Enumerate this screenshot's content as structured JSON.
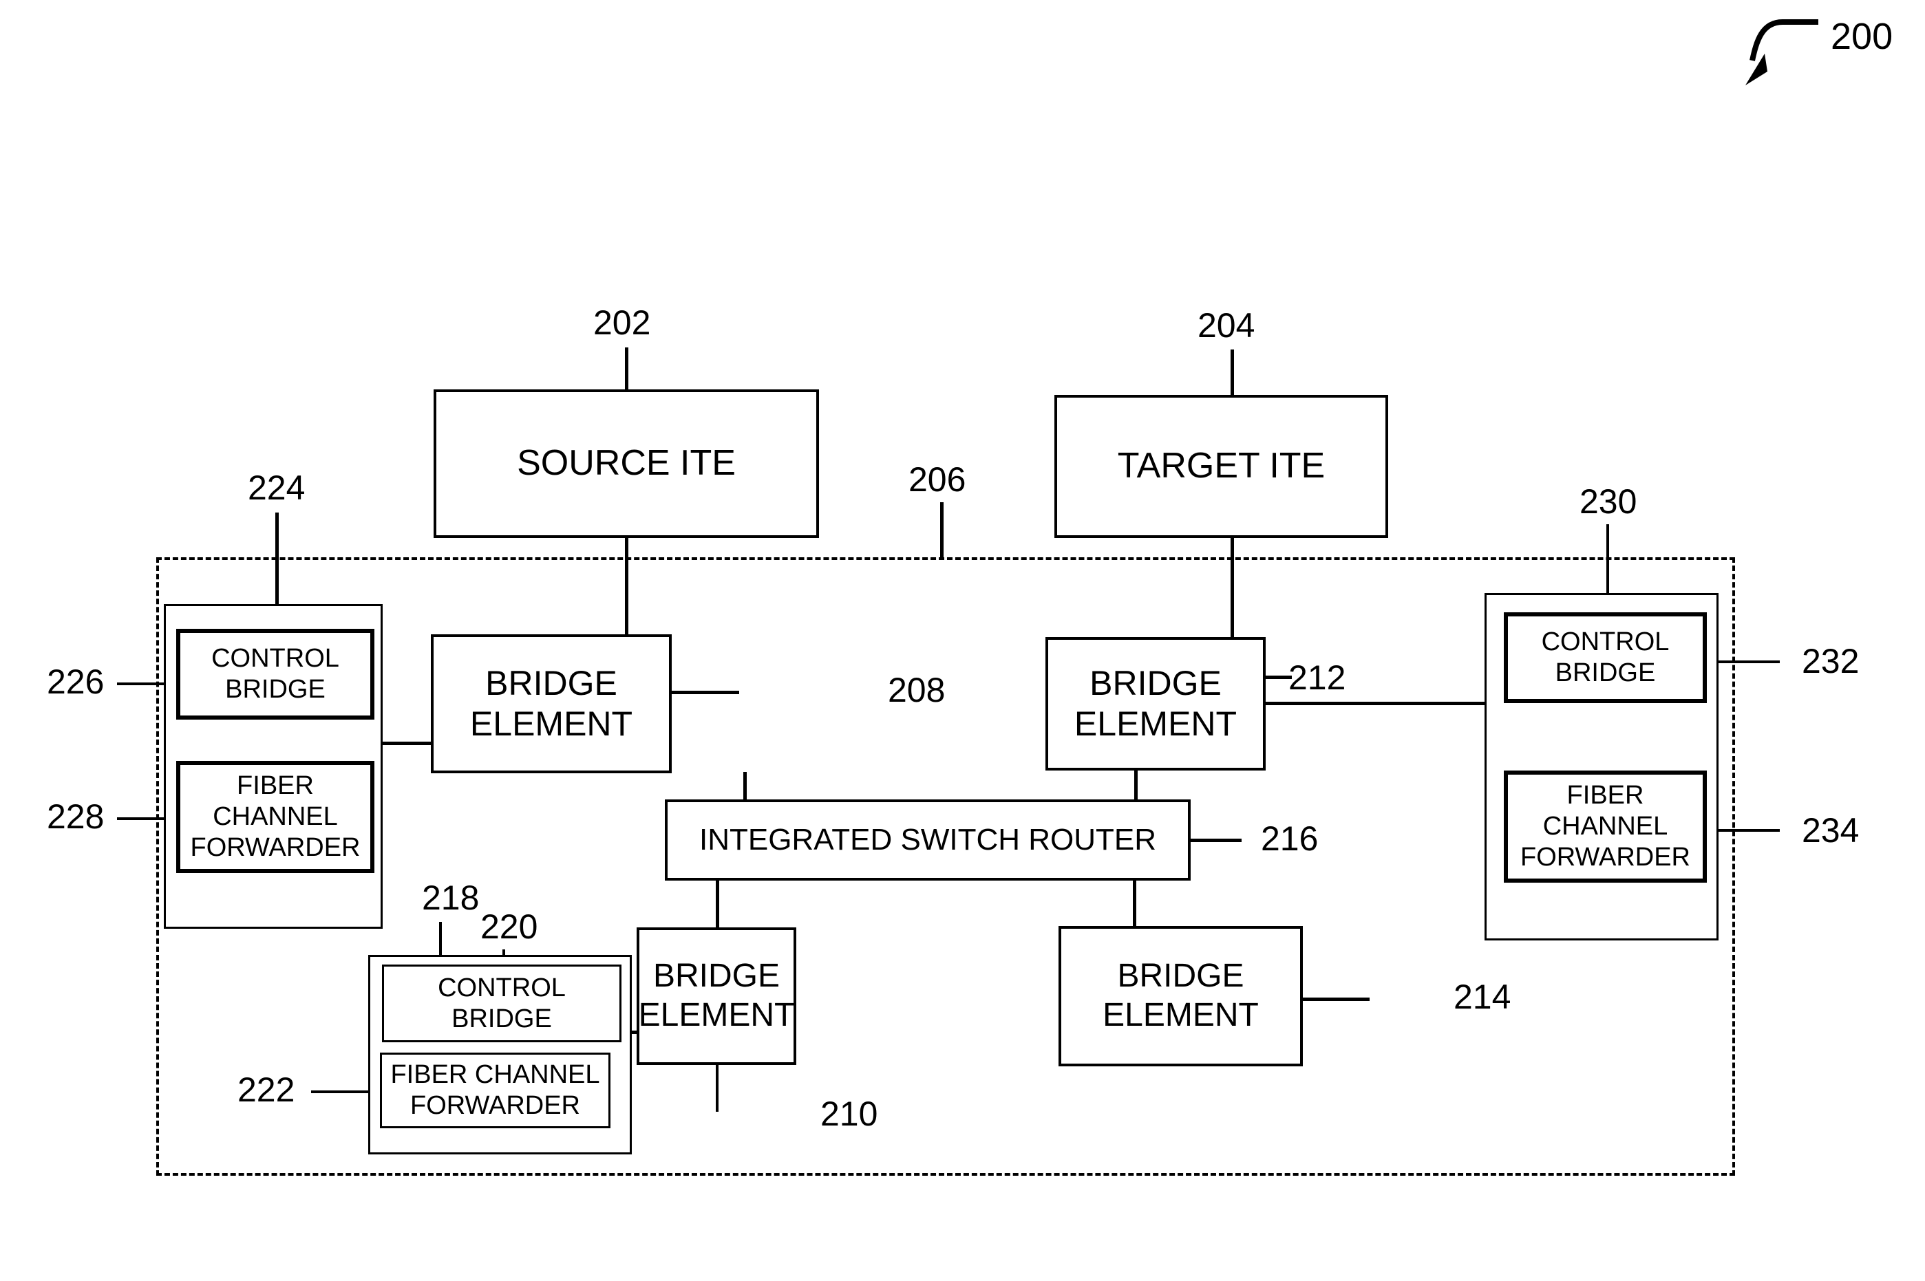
{
  "figure": {
    "number": "200",
    "type": "patent-block-diagram"
  },
  "nodes": {
    "source_ite": {
      "label": "SOURCE ITE",
      "ref": "202"
    },
    "target_ite": {
      "label": "TARGET ITE",
      "ref": "204"
    },
    "distributed_switch": {
      "ref": "206"
    },
    "bridge_element_top_left": {
      "label": "BRIDGE ELEMENT",
      "ref": "208"
    },
    "bridge_element_top_right": {
      "label": "BRIDGE ELEMENT",
      "ref": "212"
    },
    "bridge_element_bottom_left": {
      "label_line1": "BRIDGE",
      "label_line2": "ELEMENT",
      "ref": "210"
    },
    "bridge_element_bottom_right": {
      "label_line1": "BRIDGE",
      "label_line2": "ELEMENT",
      "ref": "214"
    },
    "integrated_switch_router": {
      "label": "INTEGRATED SWITCH ROUTER",
      "ref": "216"
    },
    "group_left": {
      "ref": "224",
      "control_bridge": {
        "label_line1": "CONTROL",
        "label_line2": "BRIDGE",
        "ref": "226"
      },
      "fiber_channel_forwarder": {
        "label_line1": "FIBER",
        "label_line2": "CHANNEL",
        "label_line3": "FORWARDER",
        "ref": "228"
      }
    },
    "group_bottom": {
      "ref": "218",
      "control_bridge": {
        "label_line1": "CONTROL",
        "label_line2": "BRIDGE",
        "ref": "220"
      },
      "fiber_channel_forwarder": {
        "label_line1": "FIBER CHANNEL",
        "label_line2": "FORWARDER",
        "ref": "222"
      }
    },
    "group_right": {
      "ref": "230",
      "control_bridge": {
        "label_line1": "CONTROL",
        "label_line2": "BRIDGE",
        "ref": "232"
      },
      "fiber_channel_forwarder": {
        "label_line1": "FIBER",
        "label_line2": "CHANNEL",
        "label_line3": "FORWARDER",
        "ref": "234"
      }
    }
  },
  "colors": {
    "ink": "#000000",
    "paper": "#ffffff"
  }
}
